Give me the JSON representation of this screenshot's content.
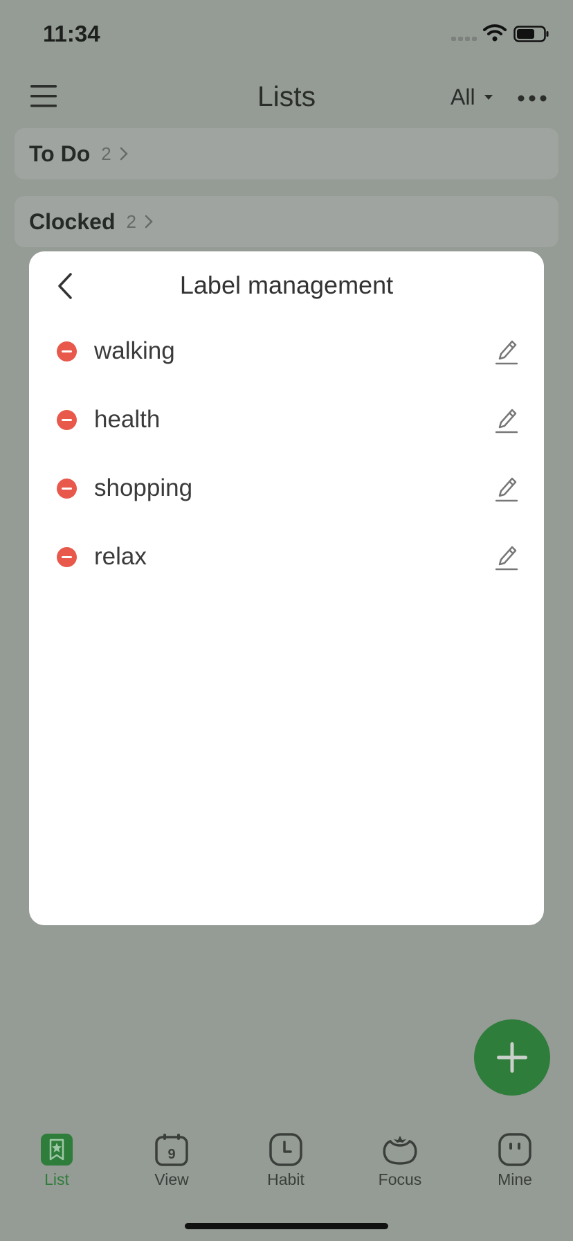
{
  "status_bar": {
    "time": "11:34"
  },
  "header": {
    "title": "Lists",
    "filter_label": "All"
  },
  "groups": [
    {
      "name": "To Do",
      "count": "2"
    },
    {
      "name": "Clocked",
      "count": "2"
    }
  ],
  "modal": {
    "title": "Label management",
    "labels": [
      {
        "name": "walking"
      },
      {
        "name": "health"
      },
      {
        "name": "shopping"
      },
      {
        "name": "relax"
      }
    ]
  },
  "tabs": [
    {
      "label": "List",
      "icon": "list-icon",
      "active": true
    },
    {
      "label": "View",
      "icon": "calendar-icon",
      "calendar_day": "9",
      "active": false
    },
    {
      "label": "Habit",
      "icon": "clock-icon",
      "active": false
    },
    {
      "label": "Focus",
      "icon": "tomato-icon",
      "active": false
    },
    {
      "label": "Mine",
      "icon": "face-icon",
      "active": false
    }
  ],
  "colors": {
    "accent": "#2e7d3b",
    "delete": "#e8584b",
    "overlay": "#959b95"
  }
}
